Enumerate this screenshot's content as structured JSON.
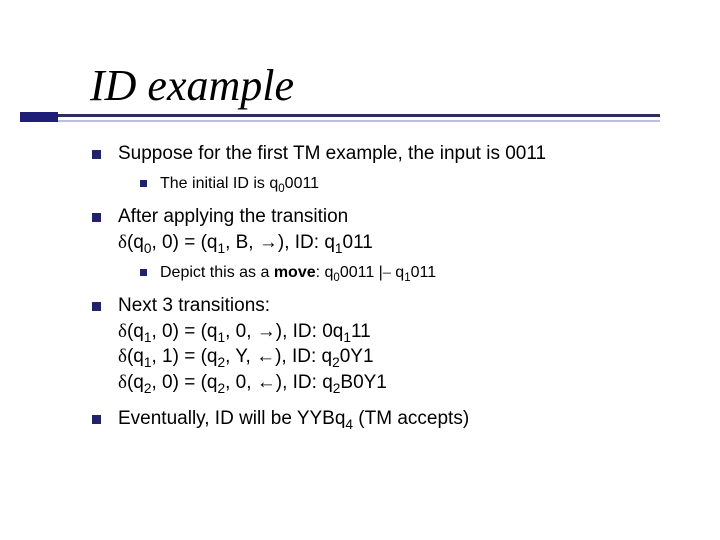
{
  "title": "ID example",
  "items": {
    "i0": "Suppose for the first TM example, the input is 0011",
    "i0s0_a": "The initial ID is q",
    "i0s0_b": "0011",
    "i1_a": "After applying the transition",
    "i1_b": "(q",
    "i1_c": ", 0) = (q",
    "i1_d": ", B, ",
    "i1_e": "), ID: q",
    "i1_f": "011",
    "i1s0_a": "Depict this as a ",
    "i1s0_b": "move",
    "i1s0_c": ": q",
    "i1s0_d": "0011  |",
    "i1s0_e": "   q",
    "i1s0_f": "011",
    "i2_a": "Next 3 transitions:",
    "i2_b": "(q",
    "i2_c": ", 0) = (q",
    "i2_d": ", 0, ",
    "i2_e": "), ID: 0q",
    "i2_f": "11",
    "i2_g": "(q",
    "i2_h": ", 1) = (q",
    "i2_i": ", Y, ",
    "i2_j": "), ID: q",
    "i2_k": "0Y1",
    "i2_l": "(q",
    "i2_m": ", 0) = (q",
    "i2_n": ", 0, ",
    "i2_o": "), ID: q",
    "i2_p": "B0Y1",
    "i3_a": "Eventually, ID will be YYBq",
    "i3_b": "  (TM accepts)"
  },
  "sub": {
    "q0": "0",
    "q1": "1",
    "q2": "2",
    "q4": "4"
  },
  "sym": {
    "delta": "δ",
    "right": "→",
    "left": "←",
    "turn": "–"
  }
}
